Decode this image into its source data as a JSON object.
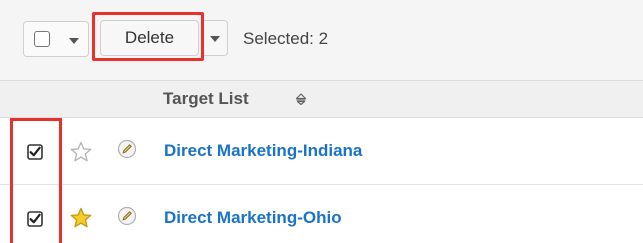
{
  "toolbar": {
    "delete_label": "Delete",
    "selected_text": "Selected: 2"
  },
  "table": {
    "column_header": "Target List",
    "rows": [
      {
        "name": "Direct Marketing-Indiana",
        "checked": true,
        "favorite": false
      },
      {
        "name": "Direct Marketing-Ohio",
        "checked": true,
        "favorite": true
      }
    ]
  },
  "colors": {
    "link": "#1a73c9",
    "highlight": "#e8312a",
    "star_favorite": "#f5cd2b"
  },
  "icons": [
    "checkbox-icon",
    "chevron-down-icon",
    "sort-icon",
    "star-icon",
    "pencil-icon"
  ]
}
